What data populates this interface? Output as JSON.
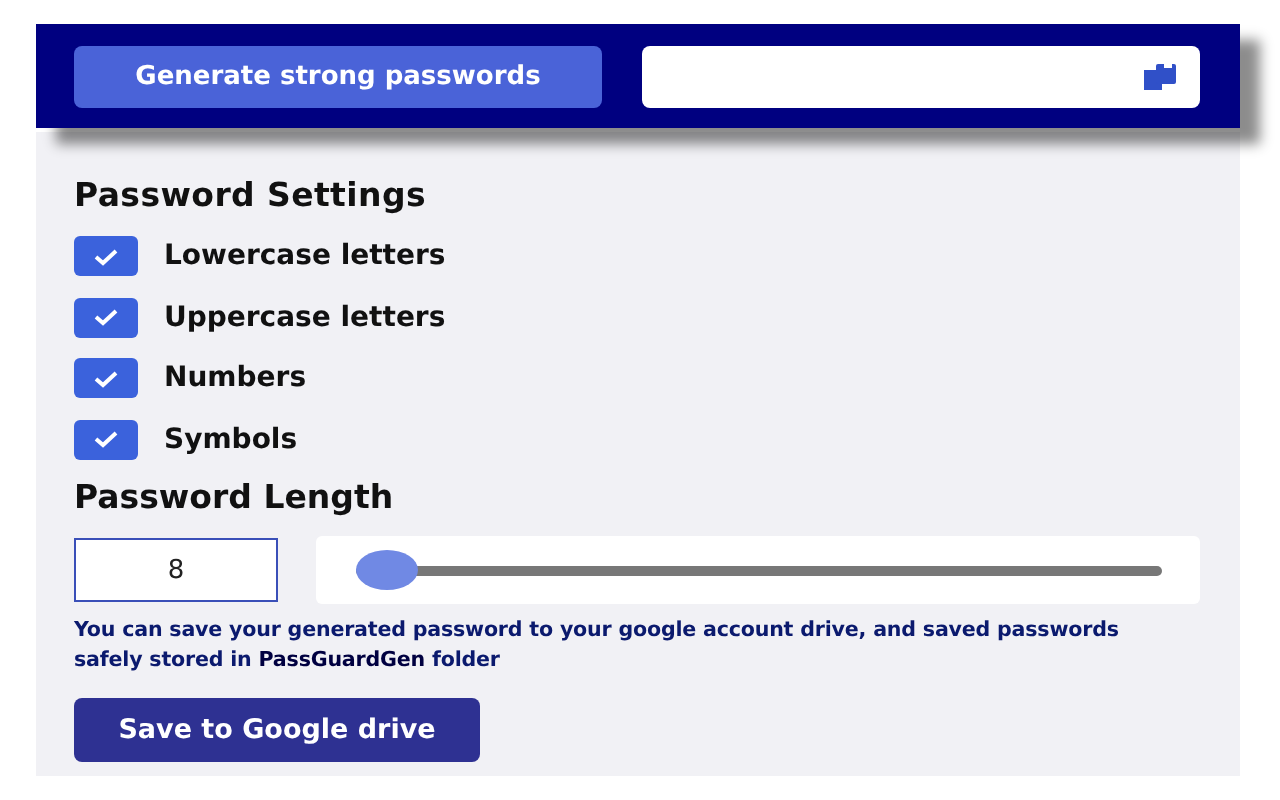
{
  "header": {
    "generate_button": "Generate strong passwords"
  },
  "settings": {
    "title": "Password Settings",
    "options": [
      {
        "label": "Lowercase letters",
        "checked": true
      },
      {
        "label": "Uppercase letters",
        "checked": true
      },
      {
        "label": "Numbers",
        "checked": true
      },
      {
        "label": "Symbols",
        "checked": true
      }
    ],
    "length_title": "Password Length",
    "length_value": "8",
    "length_slider": {
      "level": 0
    },
    "note": "You can save your generated password to your google account drive, and saved passwords safely stored in **PassGuardGen** folder",
    "save_button": "Save to Google drive"
  }
}
